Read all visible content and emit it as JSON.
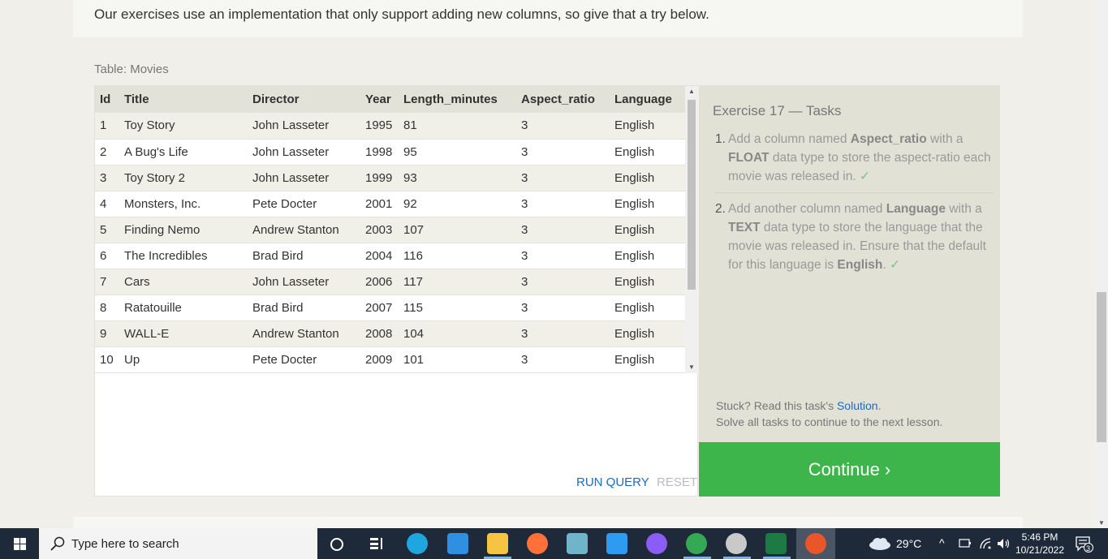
{
  "intro_text": "Our exercises use an implementation that only support adding new columns, so give that a try below.",
  "table_caption": "Table: Movies",
  "table": {
    "columns": [
      "Id",
      "Title",
      "Director",
      "Year",
      "Length_minutes",
      "Aspect_ratio",
      "Language"
    ],
    "rows": [
      [
        "1",
        "Toy Story",
        "John Lasseter",
        "1995",
        "81",
        "3",
        "English"
      ],
      [
        "2",
        "A Bug's Life",
        "John Lasseter",
        "1998",
        "95",
        "3",
        "English"
      ],
      [
        "3",
        "Toy Story 2",
        "John Lasseter",
        "1999",
        "93",
        "3",
        "English"
      ],
      [
        "4",
        "Monsters, Inc.",
        "Pete Docter",
        "2001",
        "92",
        "3",
        "English"
      ],
      [
        "5",
        "Finding Nemo",
        "Andrew Stanton",
        "2003",
        "107",
        "3",
        "English"
      ],
      [
        "6",
        "The Incredibles",
        "Brad Bird",
        "2004",
        "116",
        "3",
        "English"
      ],
      [
        "7",
        "Cars",
        "John Lasseter",
        "2006",
        "117",
        "3",
        "English"
      ],
      [
        "8",
        "Ratatouille",
        "Brad Bird",
        "2007",
        "115",
        "3",
        "English"
      ],
      [
        "9",
        "WALL-E",
        "Andrew Stanton",
        "2008",
        "104",
        "3",
        "English"
      ],
      [
        "10",
        "Up",
        "Pete Docter",
        "2009",
        "101",
        "3",
        "English"
      ]
    ]
  },
  "buttons": {
    "run_query": "RUN QUERY",
    "reset": "RESET",
    "continue": "Continue ›"
  },
  "tasks": {
    "title": "Exercise 17 — Tasks",
    "items": [
      {
        "num": "1.",
        "pre": "Add a column named ",
        "bold1": "Aspect_ratio",
        "mid": " with a ",
        "bold2": "FLOAT",
        "post": " data type to store the aspect-ratio each movie was released in.",
        "check": "✓"
      },
      {
        "num": "2.",
        "pre": "Add another column named ",
        "bold1": "Language",
        "mid": " with a ",
        "bold2": "TEXT",
        "post": " data type to store the language that the movie was released in. Ensure that the default for this language is ",
        "bold3": "English",
        "end": ".",
        "check": "✓"
      }
    ],
    "stuck_prefix": "Stuck? Read this task's ",
    "solution_link": "Solution",
    "stuck_suffix": ".",
    "solve_all": "Solve all tasks to continue to the next lesson."
  },
  "taskbar": {
    "search_placeholder": "Type here to search",
    "weather": "29°C",
    "time": "5:46 PM",
    "date": "10/21/2022",
    "notification_count": "3",
    "icon_colors": {
      "edge": "#1fa5e0",
      "store": "#2f8fe0",
      "explorer": "#f6c342",
      "firefox": "#ff7139",
      "vscode": "#2f9bf0",
      "github": "#8b5cf6",
      "chrome": "#34a853",
      "excel": "#1e7a45",
      "active_app": "#e8562a"
    }
  }
}
